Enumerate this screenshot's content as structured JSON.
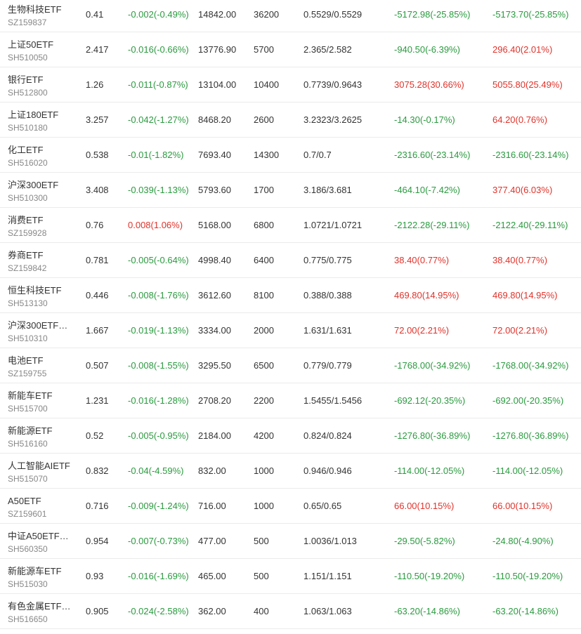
{
  "colors": {
    "up": "#e0322a",
    "down": "#2a9a3f",
    "text": "#333333",
    "subtext": "#888888",
    "divider": "#ebebeb"
  },
  "rows": [
    {
      "name": "生物科技ETF",
      "code": "SZ159837",
      "price": "0.41",
      "change": "-0.002(-0.49%)",
      "change_dir": "down",
      "market_value": "14842.00",
      "quantity": "36200",
      "cost": "0.5529/0.5529",
      "float_pnl": "-5172.98(-25.85%)",
      "float_dir": "down",
      "total_pnl": "-5173.70(-25.85%)",
      "total_dir": "down"
    },
    {
      "name": "上证50ETF",
      "code": "SH510050",
      "price": "2.417",
      "change": "-0.016(-0.66%)",
      "change_dir": "down",
      "market_value": "13776.90",
      "quantity": "5700",
      "cost": "2.365/2.582",
      "float_pnl": "-940.50(-6.39%)",
      "float_dir": "down",
      "total_pnl": "296.40(2.01%)",
      "total_dir": "up"
    },
    {
      "name": "银行ETF",
      "code": "SH512800",
      "price": "1.26",
      "change": "-0.011(-0.87%)",
      "change_dir": "down",
      "market_value": "13104.00",
      "quantity": "10400",
      "cost": "0.7739/0.9643",
      "float_pnl": "3075.28(30.66%)",
      "float_dir": "up",
      "total_pnl": "5055.80(25.49%)",
      "total_dir": "up"
    },
    {
      "name": "上证180ETF",
      "code": "SH510180",
      "price": "3.257",
      "change": "-0.042(-1.27%)",
      "change_dir": "down",
      "market_value": "8468.20",
      "quantity": "2600",
      "cost": "3.2323/3.2625",
      "float_pnl": "-14.30(-0.17%)",
      "float_dir": "down",
      "total_pnl": "64.20(0.76%)",
      "total_dir": "up"
    },
    {
      "name": "化工ETF",
      "code": "SH516020",
      "price": "0.538",
      "change": "-0.01(-1.82%)",
      "change_dir": "down",
      "market_value": "7693.40",
      "quantity": "14300",
      "cost": "0.7/0.7",
      "float_pnl": "-2316.60(-23.14%)",
      "float_dir": "down",
      "total_pnl": "-2316.60(-23.14%)",
      "total_dir": "down"
    },
    {
      "name": "沪深300ETF",
      "code": "SH510300",
      "price": "3.408",
      "change": "-0.039(-1.13%)",
      "change_dir": "down",
      "market_value": "5793.60",
      "quantity": "1700",
      "cost": "3.186/3.681",
      "float_pnl": "-464.10(-7.42%)",
      "float_dir": "down",
      "total_pnl": "377.40(6.03%)",
      "total_dir": "up"
    },
    {
      "name": "消费ETF",
      "code": "SZ159928",
      "price": "0.76",
      "change": "0.008(1.06%)",
      "change_dir": "up",
      "market_value": "5168.00",
      "quantity": "6800",
      "cost": "1.0721/1.0721",
      "float_pnl": "-2122.28(-29.11%)",
      "float_dir": "down",
      "total_pnl": "-2122.40(-29.11%)",
      "total_dir": "down"
    },
    {
      "name": "券商ETF",
      "code": "SZ159842",
      "price": "0.781",
      "change": "-0.005(-0.64%)",
      "change_dir": "down",
      "market_value": "4998.40",
      "quantity": "6400",
      "cost": "0.775/0.775",
      "float_pnl": "38.40(0.77%)",
      "float_dir": "up",
      "total_pnl": "38.40(0.77%)",
      "total_dir": "up"
    },
    {
      "name": "恒生科技ETF",
      "code": "SH513130",
      "price": "0.446",
      "change": "-0.008(-1.76%)",
      "change_dir": "down",
      "market_value": "3612.60",
      "quantity": "8100",
      "cost": "0.388/0.388",
      "float_pnl": "469.80(14.95%)",
      "float_dir": "up",
      "total_pnl": "469.80(14.95%)",
      "total_dir": "up"
    },
    {
      "name": "沪深300ETF…",
      "code": "SH510310",
      "price": "1.667",
      "change": "-0.019(-1.13%)",
      "change_dir": "down",
      "market_value": "3334.00",
      "quantity": "2000",
      "cost": "1.631/1.631",
      "float_pnl": "72.00(2.21%)",
      "float_dir": "up",
      "total_pnl": "72.00(2.21%)",
      "total_dir": "up"
    },
    {
      "name": "电池ETF",
      "code": "SZ159755",
      "price": "0.507",
      "change": "-0.008(-1.55%)",
      "change_dir": "down",
      "market_value": "3295.50",
      "quantity": "6500",
      "cost": "0.779/0.779",
      "float_pnl": "-1768.00(-34.92%)",
      "float_dir": "down",
      "total_pnl": "-1768.00(-34.92%)",
      "total_dir": "down"
    },
    {
      "name": "新能车ETF",
      "code": "SH515700",
      "price": "1.231",
      "change": "-0.016(-1.28%)",
      "change_dir": "down",
      "market_value": "2708.20",
      "quantity": "2200",
      "cost": "1.5455/1.5456",
      "float_pnl": "-692.12(-20.35%)",
      "float_dir": "down",
      "total_pnl": "-692.00(-20.35%)",
      "total_dir": "down"
    },
    {
      "name": "新能源ETF",
      "code": "SH516160",
      "price": "0.52",
      "change": "-0.005(-0.95%)",
      "change_dir": "down",
      "market_value": "2184.00",
      "quantity": "4200",
      "cost": "0.824/0.824",
      "float_pnl": "-1276.80(-36.89%)",
      "float_dir": "down",
      "total_pnl": "-1276.80(-36.89%)",
      "total_dir": "down"
    },
    {
      "name": "人工智能AIETF",
      "code": "SH515070",
      "price": "0.832",
      "change": "-0.04(-4.59%)",
      "change_dir": "down",
      "market_value": "832.00",
      "quantity": "1000",
      "cost": "0.946/0.946",
      "float_pnl": "-114.00(-12.05%)",
      "float_dir": "down",
      "total_pnl": "-114.00(-12.05%)",
      "total_dir": "down"
    },
    {
      "name": "A50ETF",
      "code": "SZ159601",
      "price": "0.716",
      "change": "-0.009(-1.24%)",
      "change_dir": "down",
      "market_value": "716.00",
      "quantity": "1000",
      "cost": "0.65/0.65",
      "float_pnl": "66.00(10.15%)",
      "float_dir": "up",
      "total_pnl": "66.00(10.15%)",
      "total_dir": "up"
    },
    {
      "name": "中证A50ETF…",
      "code": "SH560350",
      "price": "0.954",
      "change": "-0.007(-0.73%)",
      "change_dir": "down",
      "market_value": "477.00",
      "quantity": "500",
      "cost": "1.0036/1.013",
      "float_pnl": "-29.50(-5.82%)",
      "float_dir": "down",
      "total_pnl": "-24.80(-4.90%)",
      "total_dir": "down"
    },
    {
      "name": "新能源车ETF",
      "code": "SH515030",
      "price": "0.93",
      "change": "-0.016(-1.69%)",
      "change_dir": "down",
      "market_value": "465.00",
      "quantity": "500",
      "cost": "1.151/1.151",
      "float_pnl": "-110.50(-19.20%)",
      "float_dir": "down",
      "total_pnl": "-110.50(-19.20%)",
      "total_dir": "down"
    },
    {
      "name": "有色金属ETF…",
      "code": "SH516650",
      "price": "0.905",
      "change": "-0.024(-2.58%)",
      "change_dir": "down",
      "market_value": "362.00",
      "quantity": "400",
      "cost": "1.063/1.063",
      "float_pnl": "-63.20(-14.86%)",
      "float_dir": "down",
      "total_pnl": "-63.20(-14.86%)",
      "total_dir": "down"
    }
  ]
}
